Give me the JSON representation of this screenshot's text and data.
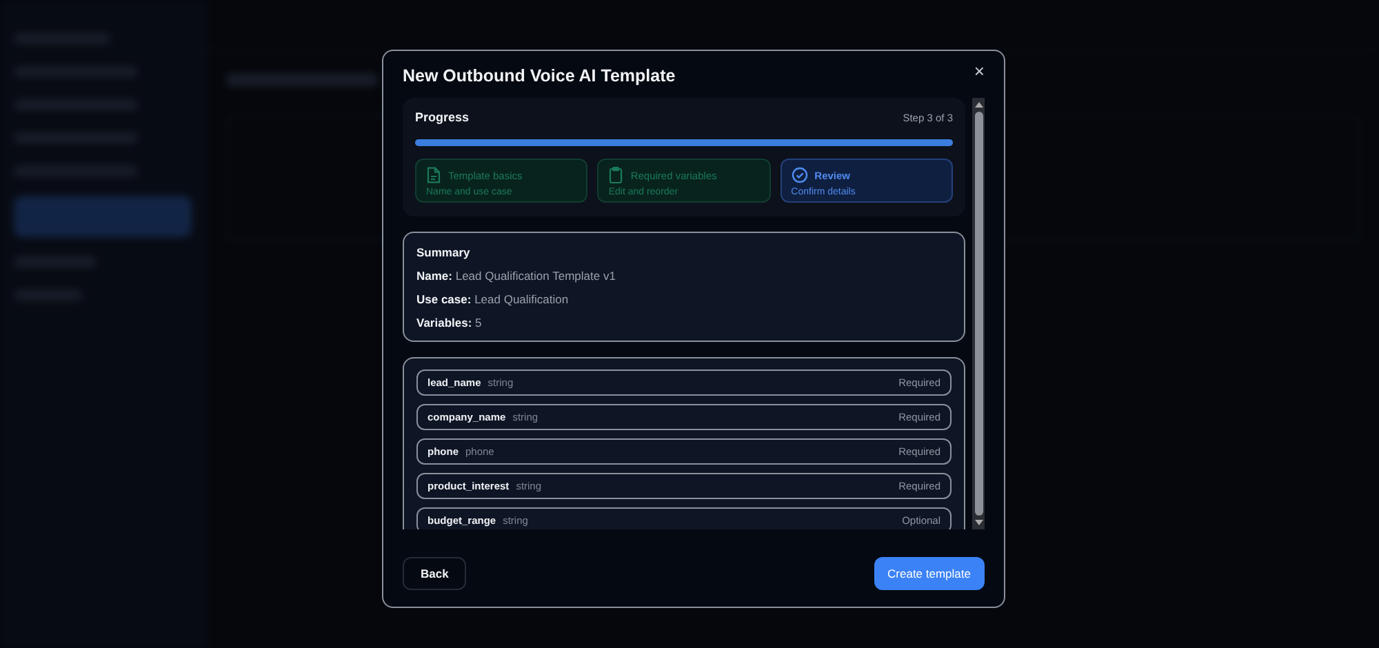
{
  "dialog": {
    "title": "New Outbound Voice AI Template",
    "close": "×"
  },
  "progress": {
    "title": "Progress",
    "step_label": "Step 3 of 3",
    "level": 1,
    "steps": [
      {
        "kind": "document",
        "title": "Template basics",
        "subtitle": "Name and use case",
        "completed": true,
        "current": false
      },
      {
        "kind": "clipboard",
        "title": "Required variables",
        "subtitle": "Edit and reorder",
        "completed": true,
        "current": false
      },
      {
        "kind": "check",
        "title": "Review",
        "subtitle": "Confirm details",
        "completed": false,
        "current": true
      }
    ]
  },
  "summary": {
    "title": "Summary",
    "lines": [
      "**Name:** Lead Qualification Template v1",
      "**Use case:** Lead Qualification",
      "**Variables:** 5"
    ]
  },
  "variables": [
    {
      "name": "lead_name",
      "type": "string",
      "requirement": "Required"
    },
    {
      "name": "company_name",
      "type": "string",
      "requirement": "Required"
    },
    {
      "name": "phone",
      "type": "phone",
      "requirement": "Required"
    },
    {
      "name": "product_interest",
      "type": "string",
      "requirement": "Required"
    },
    {
      "name": "budget_range",
      "type": "string",
      "requirement": "Optional"
    }
  ],
  "buttons": {
    "back": "Back",
    "create": "Create template"
  }
}
